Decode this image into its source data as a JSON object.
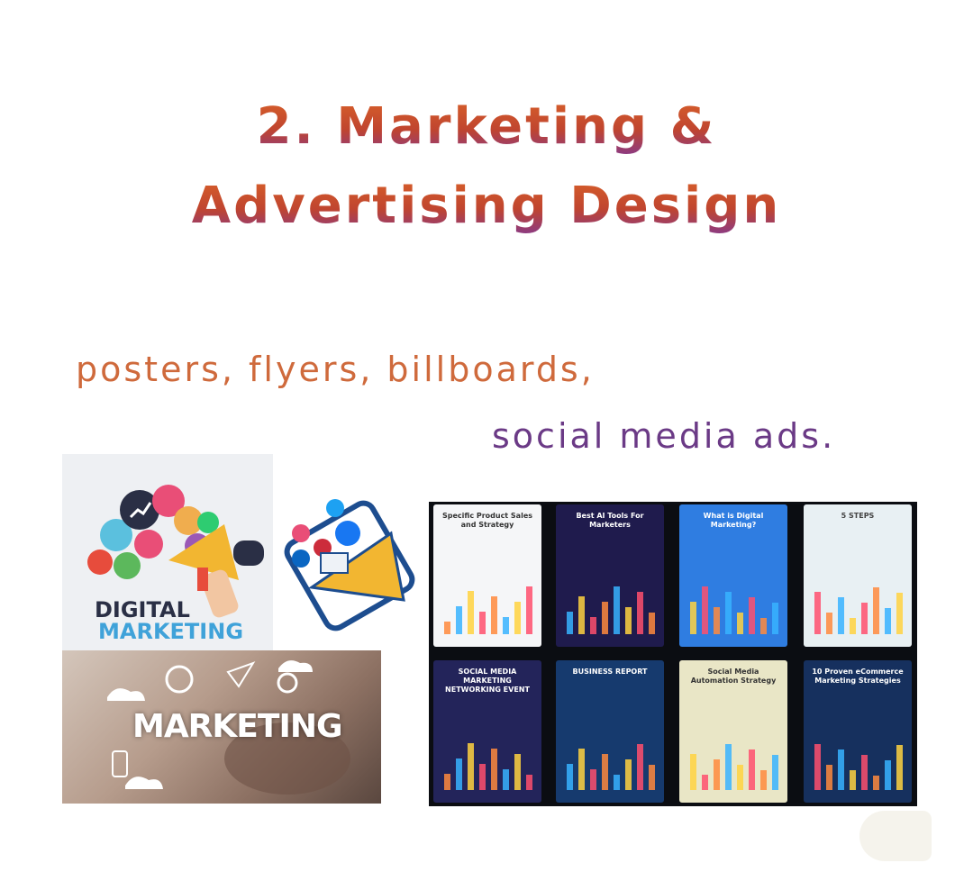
{
  "heading": {
    "line1": "2. Marketing &",
    "line2": "Advertising Design"
  },
  "subtitle": {
    "line1": "posters, flyers, billboards,",
    "line2": "social media ads."
  },
  "images": {
    "digital_marketing": {
      "line1": "DIGITAL",
      "line2": "MARKETING"
    },
    "marketing_photo": {
      "word": "MARKETING"
    },
    "infographics": [
      {
        "label": "Specific Product Sales and Strategy",
        "bg": "#f5f6f8",
        "fg": "#333333"
      },
      {
        "label": "Best AI Tools For Marketers",
        "bg": "#1f1b4d",
        "fg": "#ffffff"
      },
      {
        "label": "What is Digital Marketing?",
        "bg": "#2f7de1",
        "fg": "#ffffff"
      },
      {
        "label": "5 STEPS",
        "bg": "#e8f0f3",
        "fg": "#444444"
      },
      {
        "label": "SOCIAL MEDIA MARKETING NETWORKING EVENT",
        "bg": "#23245a",
        "fg": "#ffffff"
      },
      {
        "label": "BUSINESS REPORT",
        "bg": "#163a6e",
        "fg": "#ffffff"
      },
      {
        "label": "Social Media Automation Strategy",
        "bg": "#e9e6c6",
        "fg": "#333333"
      },
      {
        "label": "10 Proven eCommerce Marketing Strategies",
        "bg": "#16305e",
        "fg": "#ffffff"
      }
    ]
  },
  "colors": {
    "title_orange": "#d8612a",
    "title_purple": "#8a3a86",
    "subtitle_orange": "#cf6a3c",
    "subtitle_purple": "#6b3a86"
  }
}
